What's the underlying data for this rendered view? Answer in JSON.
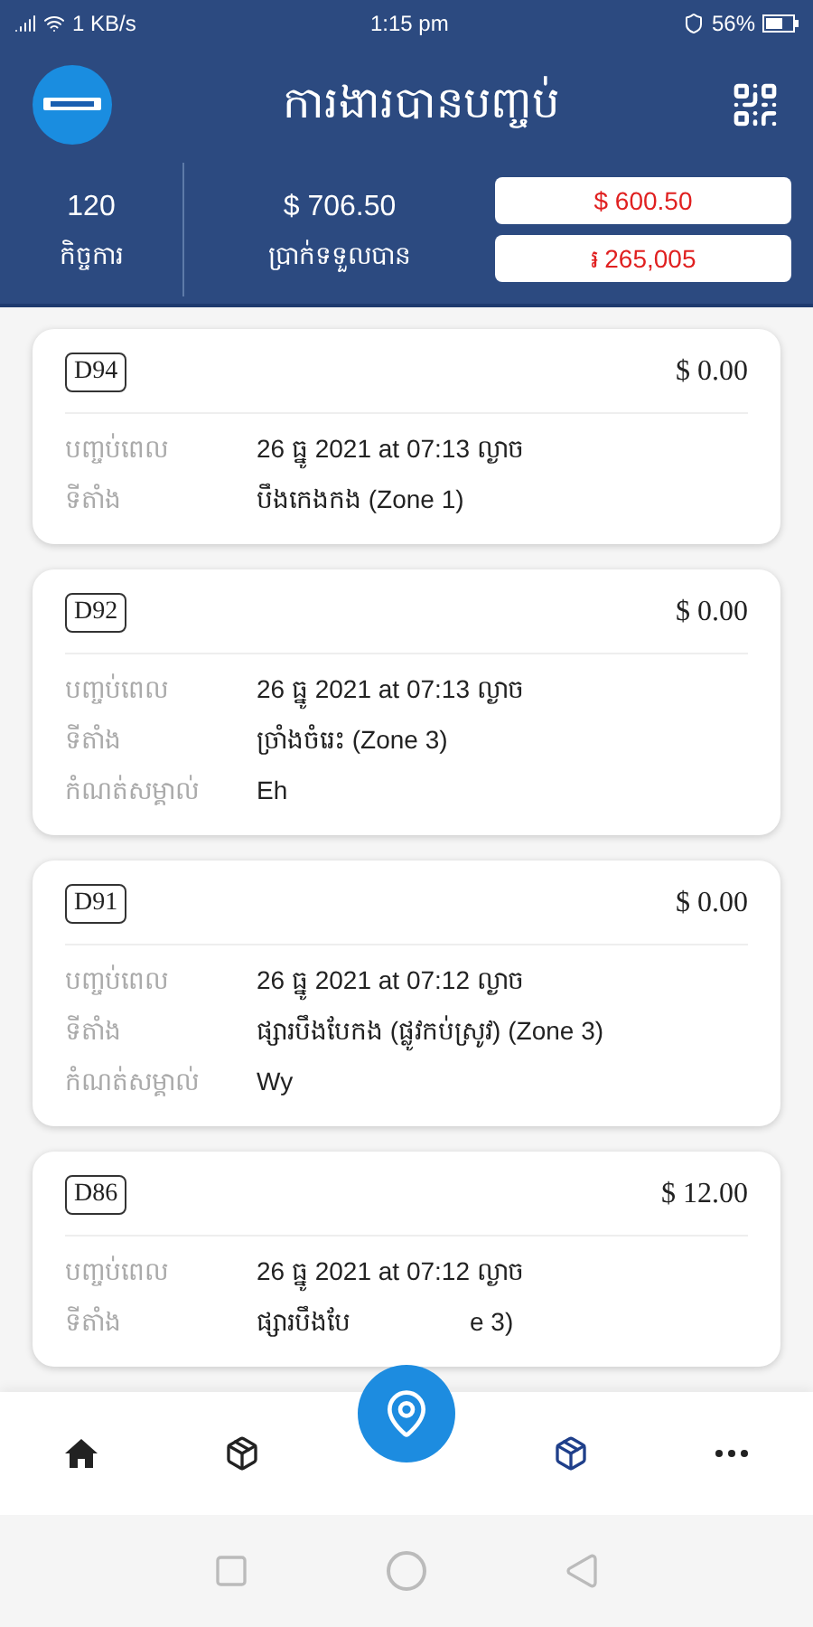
{
  "status_bar": {
    "speed": "1 KB/s",
    "time": "1:15 pm",
    "battery": "56%"
  },
  "header": {
    "title": "ការងារបានបញ្ចប់"
  },
  "summary": {
    "count": "120",
    "count_label": "កិច្ចការ",
    "total": "$ 706.50",
    "total_label": "ប្រាក់ទទួលបាន",
    "amounts": [
      "$ 600.50",
      "៛ 265,005"
    ]
  },
  "orders": [
    {
      "code": "D94",
      "price": "$ 0.00",
      "rows": [
        {
          "label": "បញ្ចប់ពេល",
          "value": "26 ធ្នូ 2021 at 07:13 ល្ងាច"
        },
        {
          "label": "ទីតាំង",
          "value": "បឹងកេងកង (Zone 1)"
        }
      ]
    },
    {
      "code": "D92",
      "price": "$ 0.00",
      "rows": [
        {
          "label": "បញ្ចប់ពេល",
          "value": "26 ធ្នូ 2021 at 07:13 ល្ងាច"
        },
        {
          "label": "ទីតាំង",
          "value": "ច្រាំងចំរេះ (Zone 3)"
        },
        {
          "label": "កំណត់សម្គាល់",
          "value": "Eh"
        }
      ]
    },
    {
      "code": "D91",
      "price": "$ 0.00",
      "rows": [
        {
          "label": "បញ្ចប់ពេល",
          "value": "26 ធ្នូ 2021 at 07:12 ល្ងាច"
        },
        {
          "label": "ទីតាំង",
          "value": "ផ្សារបឹងបែកង (ផ្លូវកប់ស្រូវ) (Zone 3)"
        },
        {
          "label": "កំណត់សម្គាល់",
          "value": "Wy"
        }
      ]
    },
    {
      "code": "D86",
      "price": "$ 12.00",
      "rows": [
        {
          "label": "បញ្ចប់ពេល",
          "value": "26 ធ្នូ 2021 at 07:12 ល្ងាច"
        },
        {
          "label": "ទីតាំង",
          "value": "ផ្សារបឹងបែ",
          "value_tail": "e 3)"
        }
      ]
    }
  ],
  "bottom_nav": [
    {
      "kind": "home",
      "selected": false
    },
    {
      "kind": "package",
      "selected": false
    },
    {
      "kind": "map",
      "selected": false
    },
    {
      "kind": "package",
      "selected": true
    },
    {
      "kind": "more",
      "selected": false
    }
  ]
}
